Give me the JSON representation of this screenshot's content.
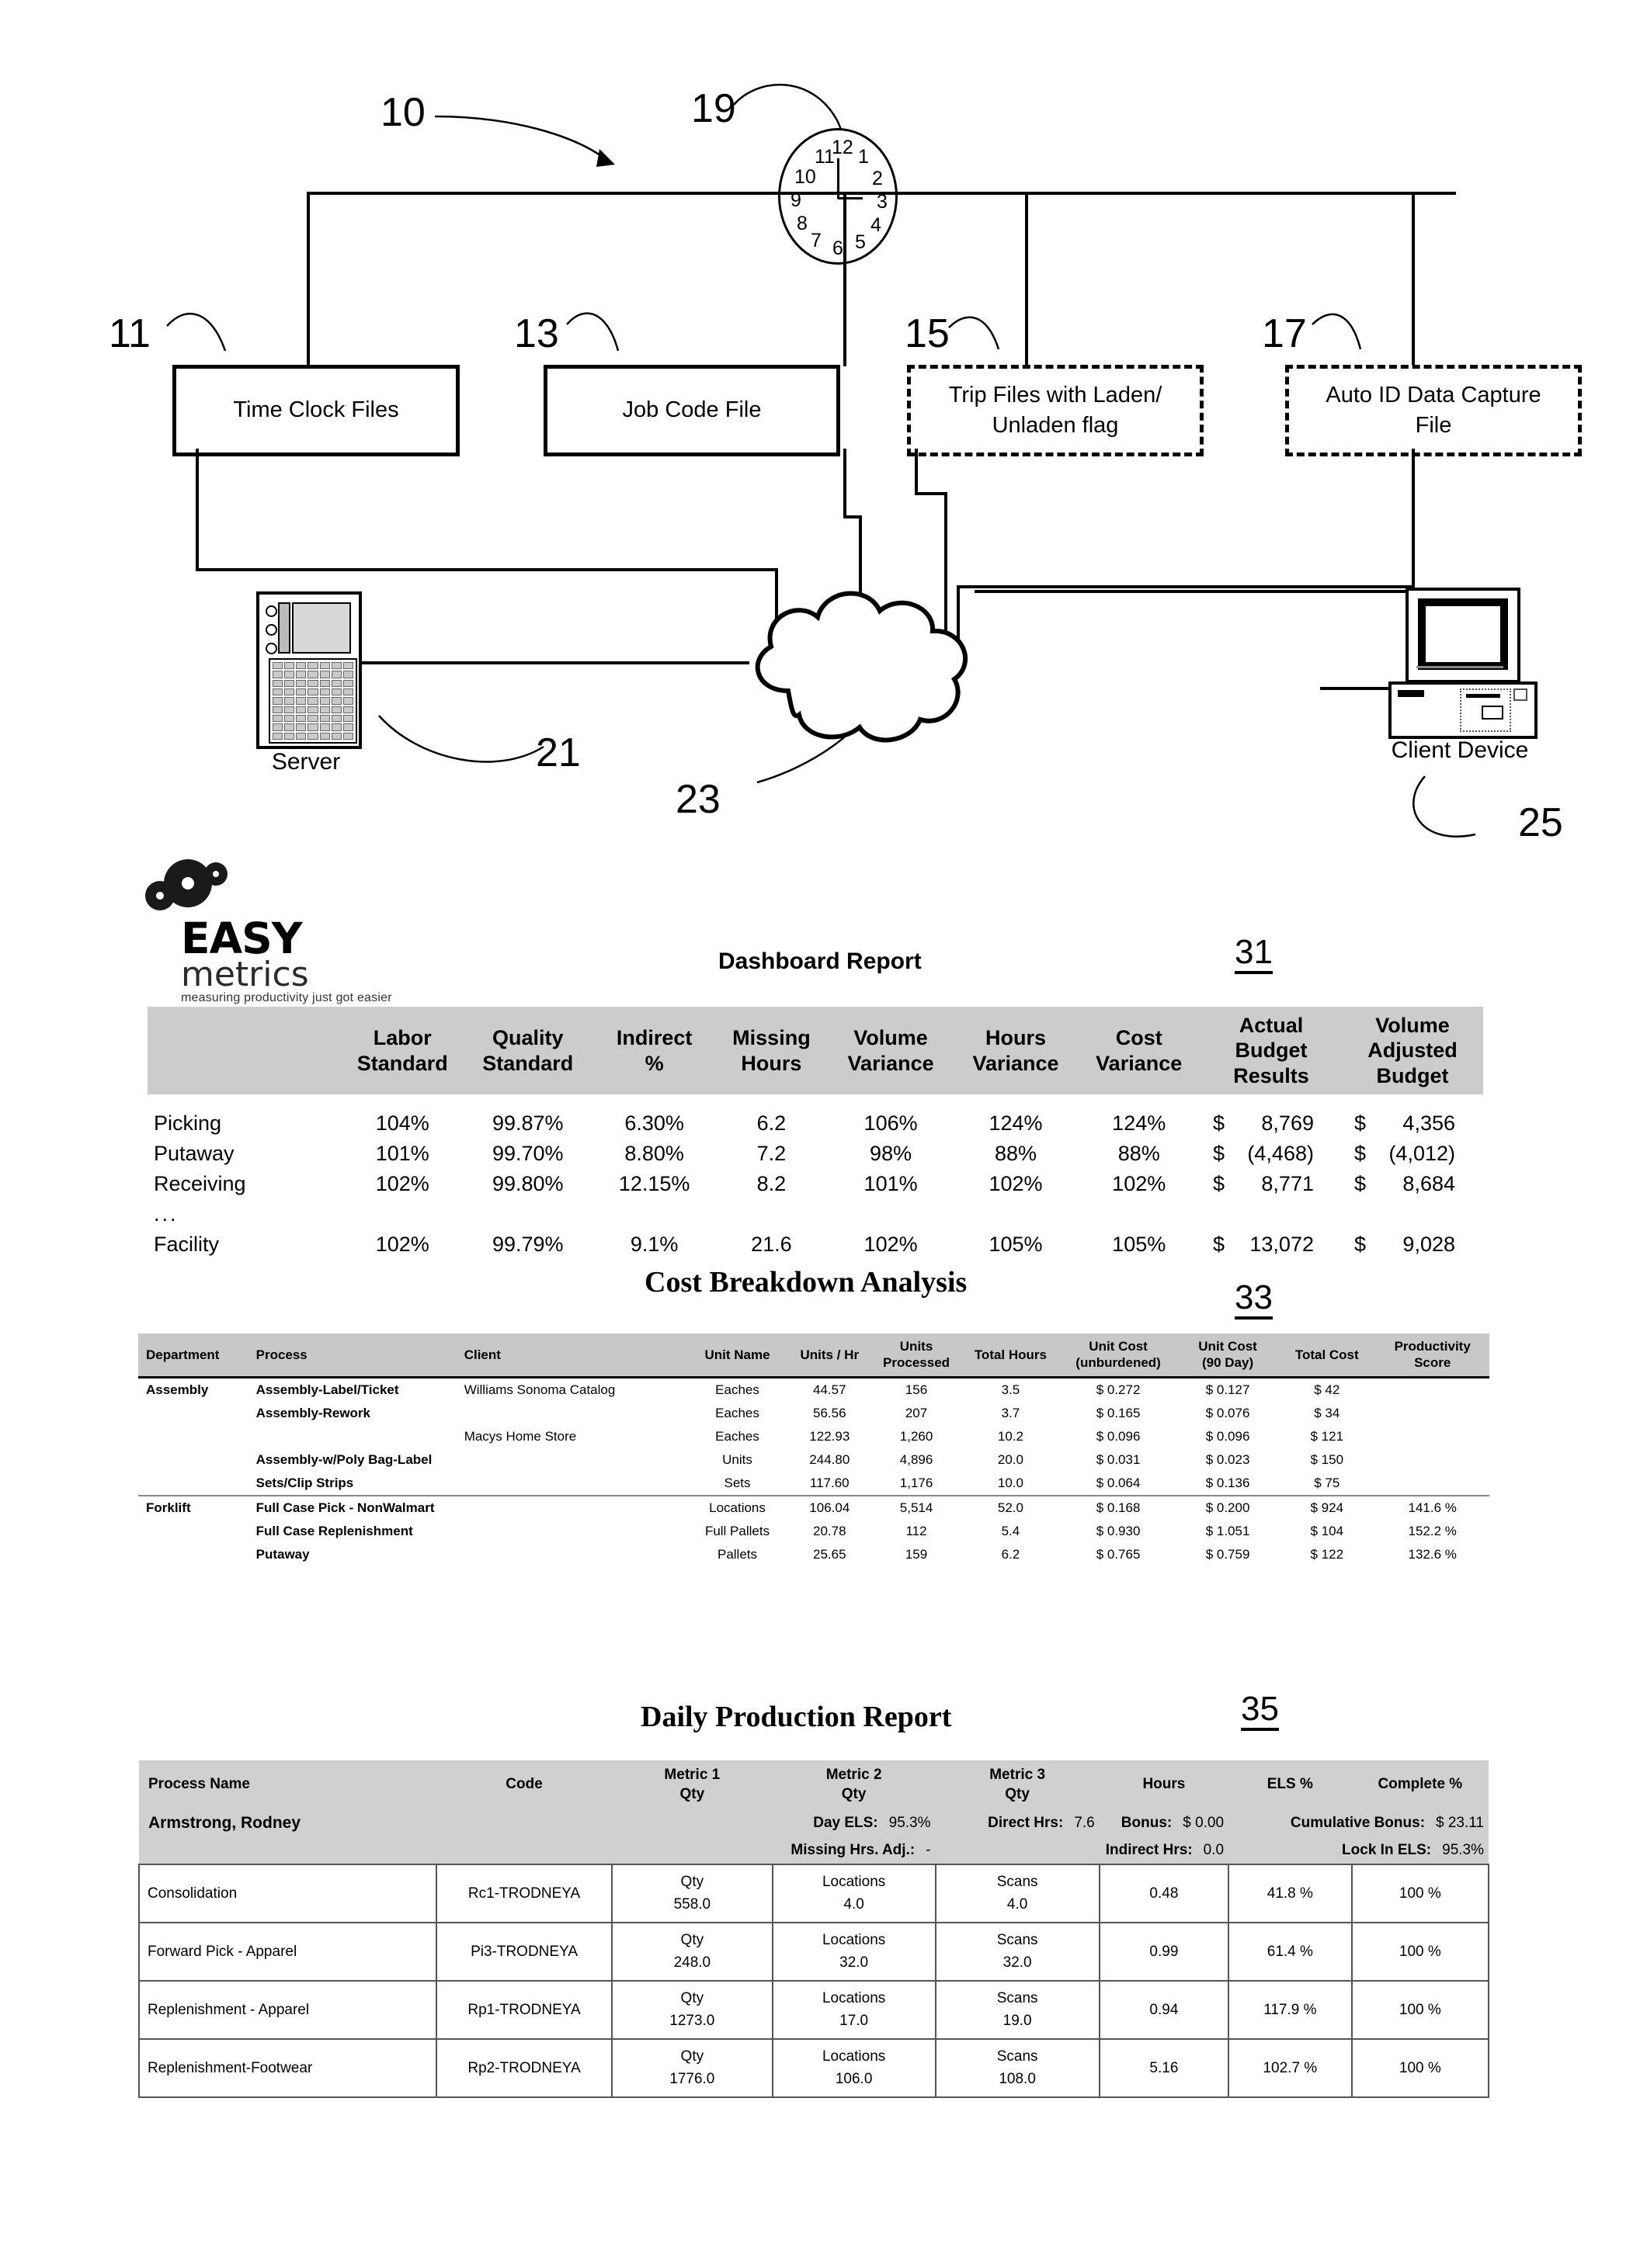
{
  "diagram": {
    "refs": {
      "system": "10",
      "time_clock_files": "11",
      "job_code_file": "13",
      "trip_files": "15",
      "auto_id_file": "17",
      "clock": "19",
      "server": "21",
      "cloud": "23",
      "client": "25",
      "dashboard_report": "31",
      "cost_breakdown": "33",
      "daily_production": "35"
    },
    "boxes": [
      {
        "id": "time-clock-files",
        "label": "Time Clock Files",
        "style": "solid"
      },
      {
        "id": "job-code-file",
        "label": "Job Code File",
        "style": "solid"
      },
      {
        "id": "trip-files",
        "label": "Trip Files with Laden/ Unladen flag",
        "line1": "Trip Files with Laden/",
        "line2": "Unladen flag",
        "style": "dashed"
      },
      {
        "id": "auto-id-data-capture-file",
        "label": "Auto ID Data Capture File",
        "line1": "Auto ID Data Capture",
        "line2": "File",
        "style": "dashed"
      }
    ],
    "server_label": "Server",
    "client_label": "Client Device",
    "clock_numerals": [
      "12",
      "1",
      "2",
      "3",
      "4",
      "5",
      "6",
      "7",
      "8",
      "9",
      "10",
      "11"
    ]
  },
  "logo": {
    "word_easy": "EASY",
    "word_metrics": "metrics",
    "tagline": "measuring productivity just got easier"
  },
  "dashboard": {
    "title": "Dashboard Report",
    "ref": "31",
    "columns": [
      {
        "l1": "",
        "l2": ""
      },
      {
        "l1": "Labor",
        "l2": "Standard"
      },
      {
        "l1": "Quality",
        "l2": "Standard"
      },
      {
        "l1": "Indirect",
        "l2": "%"
      },
      {
        "l1": "Missing",
        "l2": "Hours"
      },
      {
        "l1": "Volume",
        "l2": "Variance"
      },
      {
        "l1": "Hours",
        "l2": "Variance"
      },
      {
        "l1": "Cost",
        "l2": "Variance"
      },
      {
        "l1": "Actual Budget",
        "l2": "Results"
      },
      {
        "l1": "Volume Adjusted",
        "l2": "Budget"
      }
    ],
    "rows": [
      {
        "name": "Picking",
        "labor": "104%",
        "quality": "99.87%",
        "indirect": "6.30%",
        "missing": "6.2",
        "volvar": "106%",
        "hoursvar": "124%",
        "costvar": "124%",
        "cur1": "$",
        "actual": "8,769",
        "cur2": "$",
        "adjusted": "4,356"
      },
      {
        "name": "Putaway",
        "labor": "101%",
        "quality": "99.70%",
        "indirect": "8.80%",
        "missing": "7.2",
        "volvar": "98%",
        "hoursvar": "88%",
        "costvar": "88%",
        "cur1": "$",
        "actual": "(4,468)",
        "cur2": "$",
        "adjusted": "(4,012)"
      },
      {
        "name": "Receiving",
        "labor": "102%",
        "quality": "99.80%",
        "indirect": "12.15%",
        "missing": "8.2",
        "volvar": "101%",
        "hoursvar": "102%",
        "costvar": "102%",
        "cur1": "$",
        "actual": "8,771",
        "cur2": "$",
        "adjusted": "8,684"
      },
      {
        "name": "...",
        "labor": "",
        "quality": "",
        "indirect": "",
        "missing": "",
        "volvar": "",
        "hoursvar": "",
        "costvar": "",
        "cur1": "",
        "actual": "",
        "cur2": "",
        "adjusted": ""
      },
      {
        "name": "Facility",
        "labor": "102%",
        "quality": "99.79%",
        "indirect": "9.1%",
        "missing": "21.6",
        "volvar": "102%",
        "hoursvar": "105%",
        "costvar": "105%",
        "cur1": "$",
        "actual": "13,072",
        "cur2": "$",
        "adjusted": "9,028"
      }
    ]
  },
  "cost_breakdown": {
    "title": "Cost Breakdown Analysis",
    "ref": "33",
    "columns": [
      {
        "l1": "Department",
        "l2": ""
      },
      {
        "l1": "Process",
        "l2": ""
      },
      {
        "l1": "Client",
        "l2": ""
      },
      {
        "l1": "Unit Name",
        "l2": ""
      },
      {
        "l1": "Units / Hr",
        "l2": ""
      },
      {
        "l1": "Units",
        "l2": "Processed"
      },
      {
        "l1": "Total Hours",
        "l2": ""
      },
      {
        "l1": "Unit Cost",
        "l2": "(unburdened)"
      },
      {
        "l1": "Unit Cost",
        "l2": "(90 Day)"
      },
      {
        "l1": "Total Cost",
        "l2": ""
      },
      {
        "l1": "Productivity",
        "l2": "Score"
      }
    ],
    "rows": [
      {
        "dept": "Assembly",
        "process": "Assembly-Label/Ticket",
        "client": "Williams Sonoma Catalog",
        "unit": "Eaches",
        "uph": "44.57",
        "units": "156",
        "hours": "3.5",
        "ucu": "$ 0.272",
        "uc90": "$ 0.127",
        "total": "$ 42",
        "score": "",
        "group": "start"
      },
      {
        "dept": "",
        "process": "Assembly-Rework",
        "client": "",
        "unit": "Eaches",
        "uph": "56.56",
        "units": "207",
        "hours": "3.7",
        "ucu": "$ 0.165",
        "uc90": "$ 0.076",
        "total": "$ 34",
        "score": "",
        "group": ""
      },
      {
        "dept": "",
        "process": "",
        "client": "Macys Home Store",
        "unit": "Eaches",
        "uph": "122.93",
        "units": "1,260",
        "hours": "10.2",
        "ucu": "$ 0.096",
        "uc90": "$ 0.096",
        "total": "$ 121",
        "score": "",
        "group": ""
      },
      {
        "dept": "",
        "process": "Assembly-w/Poly Bag-Label",
        "client": "",
        "unit": "Units",
        "uph": "244.80",
        "units": "4,896",
        "hours": "20.0",
        "ucu": "$ 0.031",
        "uc90": "$ 0.023",
        "total": "$ 150",
        "score": "",
        "group": ""
      },
      {
        "dept": "",
        "process": "Sets/Clip Strips",
        "client": "",
        "unit": "Sets",
        "uph": "117.60",
        "units": "1,176",
        "hours": "10.0",
        "ucu": "$ 0.064",
        "uc90": "$ 0.136",
        "total": "$ 75",
        "score": "",
        "group": ""
      },
      {
        "dept": "Forklift",
        "process": "Full Case Pick - NonWalmart",
        "client": "",
        "unit": "Locations",
        "uph": "106.04",
        "units": "5,514",
        "hours": "52.0",
        "ucu": "$ 0.168",
        "uc90": "$ 0.200",
        "total": "$ 924",
        "score": "141.6 %",
        "group": "start"
      },
      {
        "dept": "",
        "process": "Full Case Replenishment",
        "client": "",
        "unit": "Full Pallets",
        "uph": "20.78",
        "units": "112",
        "hours": "5.4",
        "ucu": "$ 0.930",
        "uc90": "$ 1.051",
        "total": "$ 104",
        "score": "152.2 %",
        "group": ""
      },
      {
        "dept": "",
        "process": "Putaway",
        "client": "",
        "unit": "Pallets",
        "uph": "25.65",
        "units": "159",
        "hours": "6.2",
        "ucu": "$ 0.765",
        "uc90": "$ 0.759",
        "total": "$ 122",
        "score": "132.6 %",
        "group": ""
      }
    ]
  },
  "daily_production": {
    "title": "Daily Production Report",
    "ref": "35",
    "columns": [
      {
        "l1": "Process Name",
        "l2": ""
      },
      {
        "l1": "Code",
        "l2": ""
      },
      {
        "l1": "Metric 1",
        "l2": "Qty"
      },
      {
        "l1": "Metric 2",
        "l2": "Qty"
      },
      {
        "l1": "Metric 3",
        "l2": "Qty"
      },
      {
        "l1": "Hours",
        "l2": ""
      },
      {
        "l1": "ELS %",
        "l2": ""
      },
      {
        "l1": "Complete %",
        "l2": ""
      }
    ],
    "employee": {
      "name": "Armstrong, Rodney",
      "day_els_label": "Day ELS:",
      "day_els_value": "95.3%",
      "direct_hrs_label": "Direct Hrs:",
      "direct_hrs_value": "7.6",
      "bonus_label": "Bonus:",
      "bonus_value": "$ 0.00",
      "cumulative_label": "Cumulative Bonus:",
      "cumulative_value": "$ 23.11",
      "missing_label": "Missing Hrs. Adj.:",
      "missing_value": "-",
      "indirect_label": "Indirect Hrs:",
      "indirect_value": "0.0",
      "lock_label": "Lock In ELS:",
      "lock_value": "95.3%"
    },
    "rows": [
      {
        "process": "Consolidation",
        "code": "Rc1-TRODNEYA",
        "m1_label": "Qty",
        "m1": "558.0",
        "m2_label": "Locations",
        "m2": "4.0",
        "m3_label": "Scans",
        "m3": "4.0",
        "hours": "0.48",
        "els": "41.8 %",
        "complete": "100 %"
      },
      {
        "process": "Forward Pick - Apparel",
        "code": "Pi3-TRODNEYA",
        "m1_label": "Qty",
        "m1": "248.0",
        "m2_label": "Locations",
        "m2": "32.0",
        "m3_label": "Scans",
        "m3": "32.0",
        "hours": "0.99",
        "els": "61.4 %",
        "complete": "100 %"
      },
      {
        "process": "Replenishment - Apparel",
        "code": "Rp1-TRODNEYA",
        "m1_label": "Qty",
        "m1": "1273.0",
        "m2_label": "Locations",
        "m2": "17.0",
        "m3_label": "Scans",
        "m3": "19.0",
        "hours": "0.94",
        "els": "117.9 %",
        "complete": "100 %"
      },
      {
        "process": "Replenishment-Footwear",
        "code": "Rp2-TRODNEYA",
        "m1_label": "Qty",
        "m1": "1776.0",
        "m2_label": "Locations",
        "m2": "106.0",
        "m3_label": "Scans",
        "m3": "108.0",
        "hours": "5.16",
        "els": "102.7 %",
        "complete": "100 %"
      }
    ]
  }
}
